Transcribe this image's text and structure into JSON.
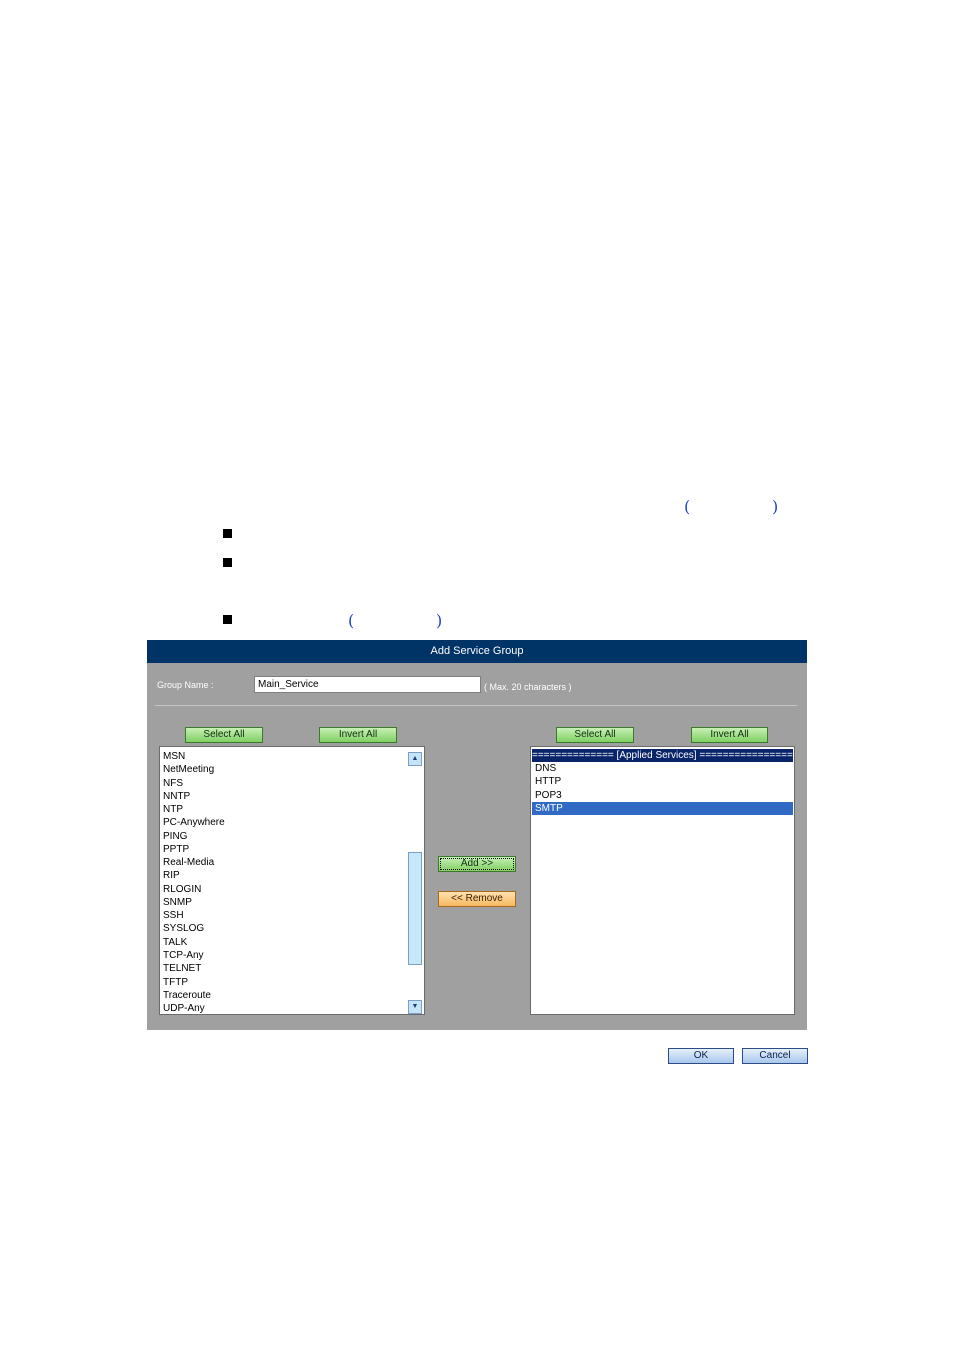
{
  "dialog": {
    "title": "Add Service Group",
    "group_name_label": "Group Name :",
    "group_name_value": "Main_Service",
    "max_chars_note": "( Max. 20 characters )"
  },
  "left": {
    "select_all_label": "Select All",
    "invert_all_label": "Invert All",
    "items": [
      "MSN",
      "NetMeeting",
      "NFS",
      "NNTP",
      "NTP",
      "PC-Anywhere",
      "PING",
      "PPTP",
      "Real-Media",
      "RIP",
      "RLOGIN",
      "SNMP",
      "SSH",
      "SYSLOG",
      "TALK",
      "TCP-Any",
      "TELNET",
      "TFTP",
      "Traceroute",
      "UDP-Any"
    ]
  },
  "middle": {
    "add_label": "Add >>",
    "remove_label": "<< Remove"
  },
  "right": {
    "select_all_label": "Select All",
    "invert_all_label": "Invert All",
    "header": "============== [Applied Services] ================",
    "items": [
      "DNS",
      "HTTP",
      "POP3",
      "SMTP"
    ],
    "selected_item": "SMTP"
  },
  "footer": {
    "ok_label": "OK",
    "cancel_label": "Cancel"
  },
  "doc": {
    "paren_open": "(",
    "paren_close": ")"
  },
  "colors": {
    "title_bar": "#003366",
    "dialog_bg": "#a0a0a0",
    "selection": "#316ac5"
  }
}
